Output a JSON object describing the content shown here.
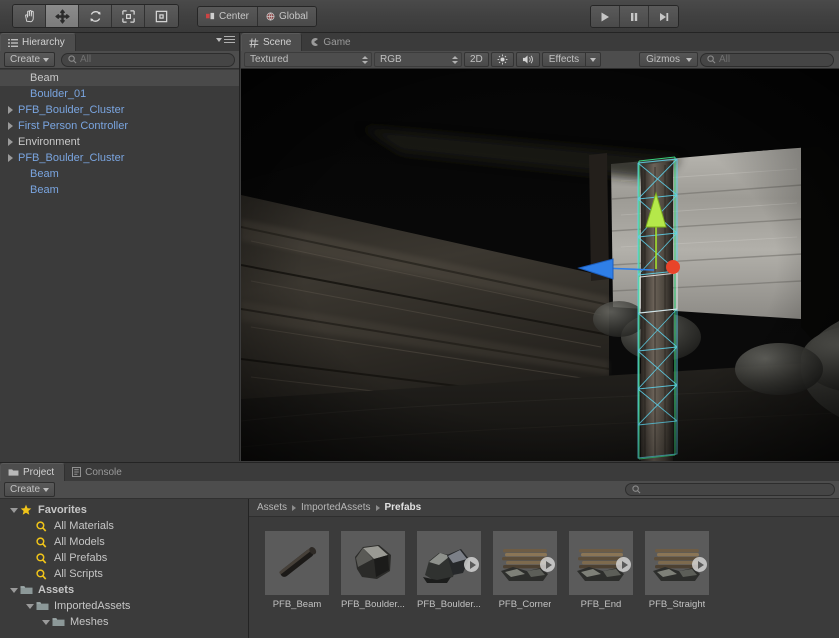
{
  "toolbar": {
    "tools": [
      {
        "name": "hand-tool",
        "icon": "hand-icon",
        "active": false
      },
      {
        "name": "move-tool",
        "icon": "move-icon",
        "active": true
      },
      {
        "name": "rotate-tool",
        "icon": "rotate-icon",
        "active": false
      },
      {
        "name": "scale-tool",
        "icon": "scale-icon",
        "active": false
      },
      {
        "name": "rect-tool",
        "icon": "rect-icon",
        "active": false
      }
    ],
    "pivot_label": "Center",
    "space_label": "Global",
    "play_label": "play-icon",
    "pause_label": "pause-icon",
    "step_label": "step-icon"
  },
  "hierarchy": {
    "tab_label": "Hierarchy",
    "tab_icon": "hierarchy-icon",
    "create_label": "Create",
    "search_placeholder": "All",
    "search_value": "",
    "items": [
      {
        "label": "Beam",
        "indent": 1,
        "expandable": false,
        "selected": true,
        "color": "white"
      },
      {
        "label": "Boulder_01",
        "indent": 1,
        "expandable": false,
        "selected": false,
        "color": "blue"
      },
      {
        "label": "PFB_Boulder_Cluster",
        "indent": 0,
        "expandable": true,
        "selected": false,
        "color": "blue"
      },
      {
        "label": "First Person Controller",
        "indent": 0,
        "expandable": true,
        "selected": false,
        "color": "blue"
      },
      {
        "label": "Environment",
        "indent": 0,
        "expandable": true,
        "selected": false,
        "color": "white"
      },
      {
        "label": "PFB_Boulder_Cluster",
        "indent": 0,
        "expandable": true,
        "selected": false,
        "color": "blue"
      },
      {
        "label": "Beam",
        "indent": 1,
        "expandable": false,
        "selected": false,
        "color": "blue"
      },
      {
        "label": "Beam",
        "indent": 1,
        "expandable": false,
        "selected": false,
        "color": "blue"
      }
    ]
  },
  "scene": {
    "tabs": [
      {
        "label": "Scene",
        "icon": "scene-grid-icon",
        "active": true
      },
      {
        "label": "Game",
        "icon": "game-pacman-icon",
        "active": false
      }
    ],
    "draw_mode": "Textured",
    "color_mode": "RGB",
    "btn_2d": "2D",
    "btn_light": "light-icon",
    "btn_audio": "audio-icon",
    "btn_effects": "Effects",
    "btn_gizmos": "Gizmos",
    "search_placeholder": "All",
    "search_value": "",
    "gizmo": {
      "axis_y_color": "#a6e22e",
      "axis_x_color": "#2f7fe8",
      "axis_z_color": "#e8442a",
      "selection_outline": "#3ddc84"
    }
  },
  "project": {
    "tabs": [
      {
        "label": "Project",
        "icon": "project-folder-icon",
        "active": true
      },
      {
        "label": "Console",
        "icon": "console-icon",
        "active": false
      }
    ],
    "create_label": "Create",
    "search_placeholder": "",
    "search_value": "",
    "tree": [
      {
        "label": "Favorites",
        "indent": 0,
        "icon": "star-icon",
        "expanded": true,
        "bold": true
      },
      {
        "label": "All Materials",
        "indent": 1,
        "icon": "search-icon",
        "expanded": null,
        "bold": false
      },
      {
        "label": "All Models",
        "indent": 1,
        "icon": "search-icon",
        "expanded": null,
        "bold": false
      },
      {
        "label": "All Prefabs",
        "indent": 1,
        "icon": "search-icon",
        "expanded": null,
        "bold": false
      },
      {
        "label": "All Scripts",
        "indent": 1,
        "icon": "search-icon",
        "expanded": null,
        "bold": false
      },
      {
        "label": "Assets",
        "indent": 0,
        "icon": "folder-icon",
        "expanded": true,
        "bold": true
      },
      {
        "label": "ImportedAssets",
        "indent": 1,
        "icon": "folder-icon",
        "expanded": true,
        "bold": false
      },
      {
        "label": "Meshes",
        "indent": 2,
        "icon": "folder-icon",
        "expanded": true,
        "bold": false
      }
    ],
    "breadcrumb": [
      "Assets",
      "ImportedAssets",
      "Prefabs"
    ],
    "assets": [
      {
        "label": "PFB_Beam",
        "kind": "beam",
        "is_prefab": false
      },
      {
        "label": "PFB_Boulder...",
        "kind": "boulder",
        "is_prefab": false
      },
      {
        "label": "PFB_Boulder...",
        "kind": "boulder-cluster",
        "is_prefab": true
      },
      {
        "label": "PFB_Corner",
        "kind": "wood-pile",
        "is_prefab": true
      },
      {
        "label": "PFB_End",
        "kind": "wood-pile",
        "is_prefab": true
      },
      {
        "label": "PFB_Straight",
        "kind": "wood-pile",
        "is_prefab": true
      }
    ]
  }
}
